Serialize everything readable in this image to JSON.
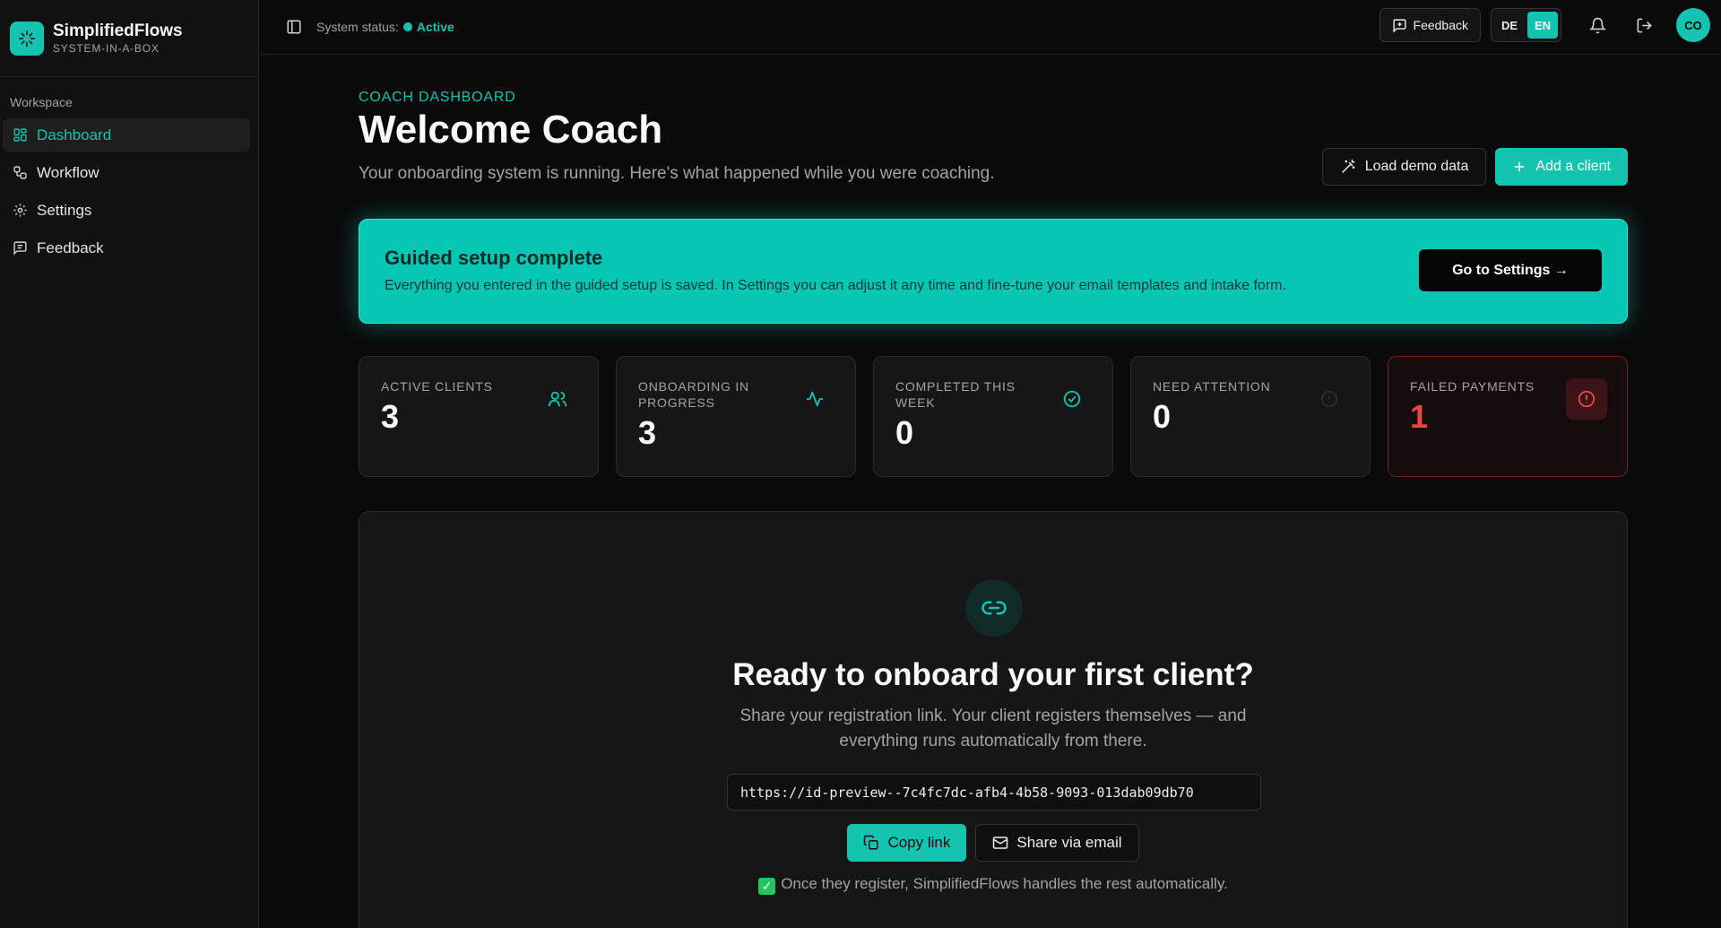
{
  "brand": {
    "name": "SimplifiedFlows",
    "tagline": "SYSTEM-IN-A-BOX",
    "logo_icon": "sparkles-icon"
  },
  "sidebar": {
    "heading": "Workspace",
    "items": [
      {
        "label": "Dashboard",
        "icon": "layout-grid-icon",
        "active": true
      },
      {
        "label": "Workflow",
        "icon": "workflow-icon",
        "active": false
      },
      {
        "label": "Settings",
        "icon": "gear-icon",
        "active": false
      },
      {
        "label": "Feedback",
        "icon": "message-square-icon",
        "active": false
      }
    ]
  },
  "header": {
    "status_label": "System status:",
    "status_value": "Active",
    "feedback_label": "Feedback",
    "languages": [
      "DE",
      "EN"
    ],
    "active_language": "EN",
    "avatar_initials": "CO"
  },
  "main": {
    "eyebrow": "COACH DASHBOARD",
    "title": "Welcome Coach",
    "subtitle": "Your onboarding system is running. Here's what happened while you were coaching.",
    "load_demo_label": "Load demo data",
    "add_client_label": "Add a client"
  },
  "banner": {
    "title": "Guided setup complete",
    "text": "Everything you entered in the guided setup is saved. In Settings you can adjust it any time and fine-tune your email templates and intake form.",
    "button_label": "Go to Settings →"
  },
  "stats": [
    {
      "label": "ACTIVE CLIENTS",
      "value": "3",
      "icon": "users-icon"
    },
    {
      "label": "ONBOARDING IN PROGRESS",
      "value": "3",
      "icon": "activity-icon"
    },
    {
      "label": "COMPLETED THIS WEEK",
      "value": "0",
      "icon": "check-circle-icon"
    },
    {
      "label": "NEED ATTENTION",
      "value": "0",
      "icon": "info-circle-icon"
    },
    {
      "label": "FAILED PAYMENTS",
      "value": "1",
      "icon": "alert-circle-icon"
    }
  ],
  "onboard": {
    "title": "Ready to onboard your first client?",
    "text_line1": "Share your registration link. Your client registers themselves — and",
    "text_line2": "everything runs automatically from there.",
    "url": "https://id-preview--7c4fc7dc-afb4-4b58-9093-013dab09db70",
    "copy_label": "Copy link",
    "share_label": "Share via email",
    "note": "Once they register, SimplifiedFlows handles the rest automatically."
  },
  "colors": {
    "accent": "#14c4b0",
    "danger": "#ef4444",
    "background": "#0a0a0a"
  }
}
